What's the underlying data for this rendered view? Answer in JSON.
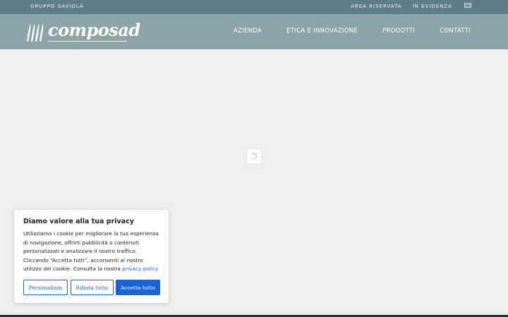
{
  "topbar": {
    "group": "GRUPPO SAVIOLA",
    "links": [
      "AREA RISERVATA",
      "IN EVIDENZA"
    ],
    "flag_icon": "flag-icon"
  },
  "header": {
    "logo": "composad",
    "nav": [
      "AZIENDA",
      "ETICA E INNOVAZIONE",
      "PRODOTTI",
      "CONTATTI"
    ]
  },
  "loader": {
    "icon": "spinner-icon"
  },
  "cookie": {
    "title": "Diamo valore alla tua privacy",
    "text": "Utilizziamo i cookie per migliorare la tua esperienza di navigazione, offrirti pubblicità o contenuti personalizzati e analizzare il nostro traffico. Cliccando “Accetta tutti”, acconsenti al nostro utilizzo dei cookie. Consulta la nostra",
    "link": "privacy policy",
    "buttons": {
      "customize": "Personalizza",
      "reject": "Rifiuta tutto",
      "accept": "Accetta tutto"
    }
  },
  "colors": {
    "topbar": "#5e7d84",
    "header": "#8da5a9",
    "accent": "#1863dc"
  }
}
